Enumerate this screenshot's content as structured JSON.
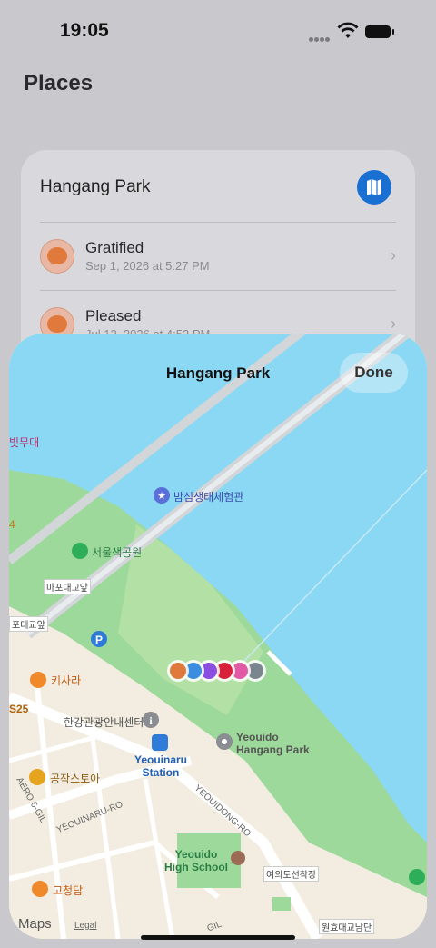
{
  "status_bar": {
    "time": "19:05"
  },
  "page": {
    "title": "Places"
  },
  "card": {
    "place_name": "Hangang Park",
    "entries": [
      {
        "mood": "Gratified",
        "date": "Sep 1, 2026 at 5:27 PM"
      },
      {
        "mood": "Pleased",
        "date": "Jul 12, 2026 at 4:52 PM"
      }
    ]
  },
  "map_sheet": {
    "title": "Hangang Park",
    "done_label": "Done",
    "attribution": "Maps",
    "legal": "Legal",
    "labels": {
      "top_left_fragment": "빛무대",
      "left_fragment_4": "4",
      "ecology": "밤섬생태체험관",
      "color_park": "서울색공원",
      "mapo_bridge_sign": "마포대교앞",
      "left_bridge_sign": "포대교앞",
      "kisara": "키사라",
      "s25": "S25",
      "tourist_center": "한강관광안내센터",
      "station": "Yeouinaru\nStation",
      "yeouido_park": "Yeouido\nHangang Park",
      "workshop": "공작스토아",
      "aero": "AERO 6-GIL",
      "yeouinaru_ro": "YEOUINARU-RO",
      "yeouidong_ro": "YEOUIDONG-RO",
      "school": "Yeouido\nHigh School",
      "yeoui_stop": "여의도선착장",
      "gochungdam": "고청담",
      "gil": "GIL",
      "wonhyo": "원효대교남단"
    },
    "pin_colors": [
      "#e07a3c",
      "#3b8de0",
      "#8a4fe0",
      "#d8203a",
      "#e25aa5",
      "#7b8590"
    ]
  }
}
